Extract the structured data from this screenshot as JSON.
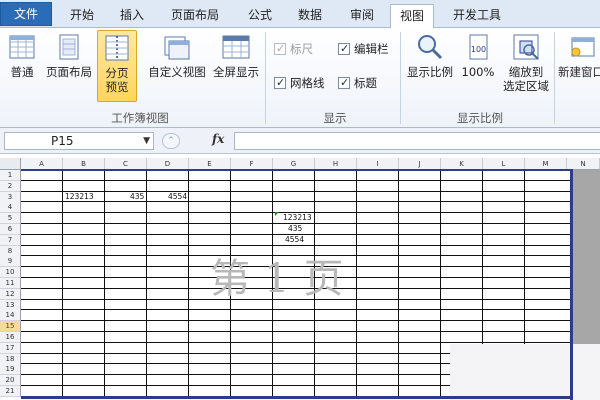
{
  "tabs": [
    {
      "label": "文件"
    },
    {
      "label": "开始"
    },
    {
      "label": "插入"
    },
    {
      "label": "页面布局"
    },
    {
      "label": "公式"
    },
    {
      "label": "数据"
    },
    {
      "label": "审阅"
    },
    {
      "label": "视图",
      "active": true
    },
    {
      "label": "开发工具"
    }
  ],
  "ribbon": {
    "workbook_views": {
      "group_label": "工作簿视图",
      "normal": "普通",
      "page_layout": "页面布局",
      "page_break_line1": "分页",
      "page_break_line2": "预览",
      "custom_views": "自定义视图",
      "full_screen": "全屏显示"
    },
    "show": {
      "group_label": "显示",
      "ruler": "标尺",
      "formula_bar": "编辑栏",
      "gridlines": "网格线",
      "headings": "标题"
    },
    "zoom": {
      "group_label": "显示比例",
      "zoom": "显示比例",
      "zoom_100": "100%",
      "zoom_selection_line1": "缩放到",
      "zoom_selection_line2": "选定区域"
    },
    "window": {
      "new_window": "新建窗口"
    }
  },
  "formula_bar": {
    "name_box": "P15",
    "fx": "fx",
    "formula": ""
  },
  "sheet": {
    "columns": [
      "A",
      "B",
      "C",
      "D",
      "E",
      "F",
      "G",
      "H",
      "I",
      "J",
      "K",
      "L",
      "M",
      "N"
    ],
    "rows": [
      "1",
      "2",
      "3",
      "4",
      "5",
      "6",
      "7",
      "8",
      "9",
      "10",
      "11",
      "12",
      "13",
      "14",
      "15",
      "16",
      "17",
      "18",
      "19",
      "20",
      "21"
    ],
    "selected_row": "15",
    "cells": {
      "b3": "123213",
      "c3": "435",
      "d3": "4554",
      "g5": "123213",
      "g6": "435",
      "g7": "4554"
    },
    "page_watermark": [
      "第",
      "1",
      "页"
    ]
  }
}
